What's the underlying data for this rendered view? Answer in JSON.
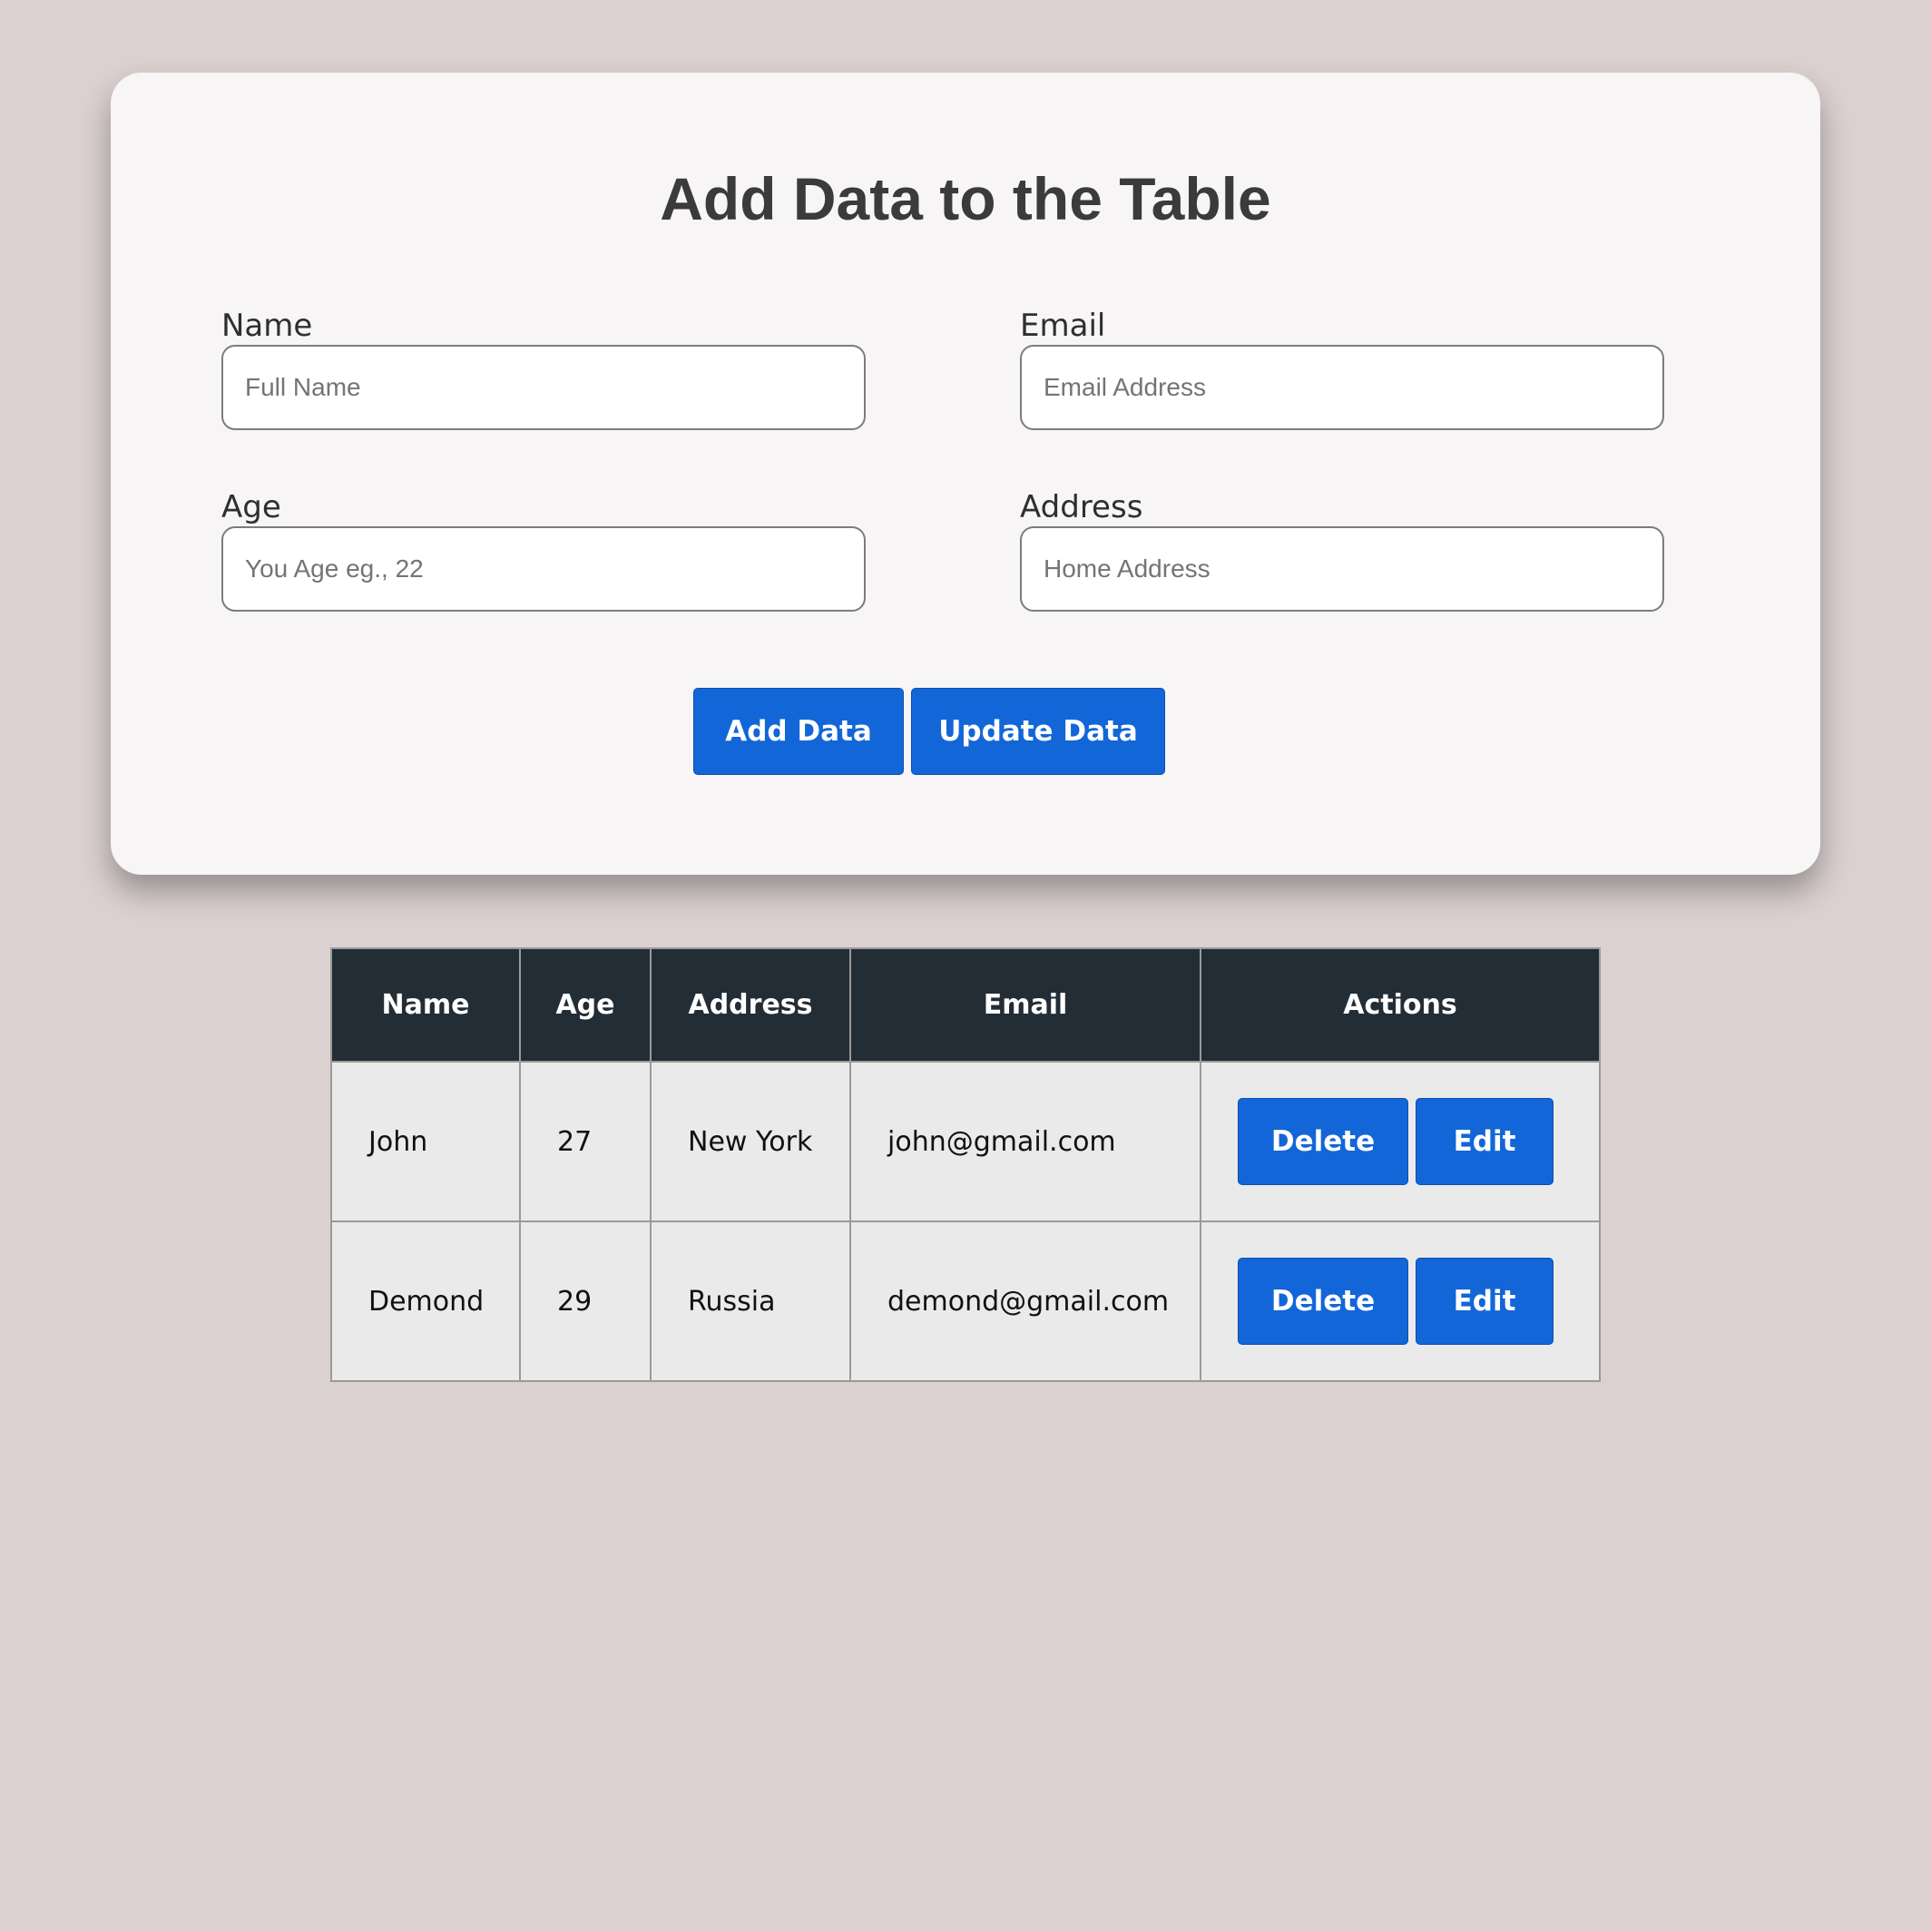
{
  "form": {
    "title": "Add Data to the Table",
    "fields": {
      "name": {
        "label": "Name",
        "placeholder": "Full Name",
        "value": ""
      },
      "email": {
        "label": "Email",
        "placeholder": "Email Address",
        "value": ""
      },
      "age": {
        "label": "Age",
        "placeholder": "You Age eg., 22",
        "value": ""
      },
      "address": {
        "label": "Address",
        "placeholder": "Home Address",
        "value": ""
      }
    },
    "add_label": "Add Data",
    "update_label": "Update Data"
  },
  "table": {
    "headers": [
      "Name",
      "Age",
      "Address",
      "Email",
      "Actions"
    ],
    "rows": [
      {
        "name": "John",
        "age": "27",
        "address": "New York",
        "email": "john@gmail.com",
        "delete_label": "Delete",
        "edit_label": "Edit"
      },
      {
        "name": "Demond",
        "age": "29",
        "address": "Russia",
        "email": "demond@gmail.com",
        "delete_label": "Delete",
        "edit_label": "Edit"
      }
    ]
  },
  "colors": {
    "background": "#dbd1d0",
    "card": "#f7f5f6",
    "primary_button": "#1266d8",
    "table_header": "#232d36",
    "table_cell": "#ebeaea"
  }
}
